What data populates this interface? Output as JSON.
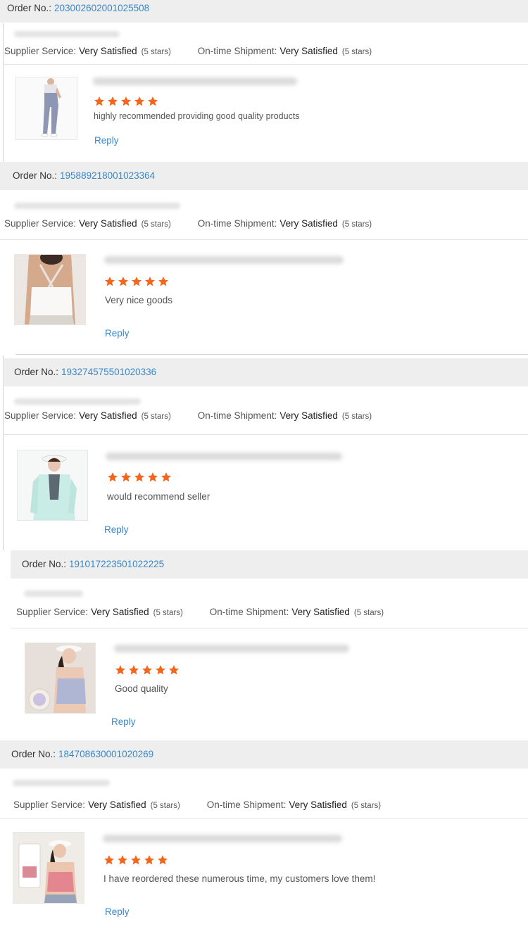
{
  "labels": {
    "order": "Order No.:",
    "supplier_service": "Supplier Service:",
    "ontime_shipment": "On-time Shipment:",
    "reply": "Reply"
  },
  "colors": {
    "link": "#3a87c9",
    "star": "#f2661d",
    "order_bar": "#eeeeee"
  },
  "reviews": [
    {
      "order_no": "203002602001025508",
      "supplier_service": "Very Satisfied",
      "supplier_stars": "(5 stars)",
      "ontime_shipment": "Very Satisfied",
      "ontime_stars": "(5 stars)",
      "rating": 5,
      "comment": "highly recommended providing good quality products",
      "product_image": "leggings-photo"
    },
    {
      "order_no": "195889218001023364",
      "supplier_service": "Very Satisfied",
      "supplier_stars": "(5 stars)",
      "ontime_shipment": "Very Satisfied",
      "ontime_stars": "(5 stars)",
      "rating": 5,
      "comment": "Very nice goods",
      "product_image": "white-sports-bra-photo"
    },
    {
      "order_no": "193274575501020336",
      "supplier_service": "Very Satisfied",
      "supplier_stars": "(5 stars)",
      "ontime_shipment": "Very Satisfied",
      "ontime_stars": "(5 stars)",
      "rating": 5,
      "comment": "would recommend seller",
      "product_image": "mint-jacket-photo"
    },
    {
      "order_no": "191017223501022225",
      "supplier_service": "Very Satisfied",
      "supplier_stars": "(5 stars)",
      "ontime_shipment": "Very Satisfied",
      "ontime_stars": "(5 stars)",
      "rating": 5,
      "comment": "Good quality",
      "product_image": "lavender-bra-photo"
    },
    {
      "order_no": "184708630001020269",
      "supplier_service": "Very Satisfied",
      "supplier_stars": "(5 stars)",
      "ontime_shipment": "Very Satisfied",
      "ontime_stars": "(5 stars)",
      "rating": 5,
      "comment": "I have reordered these numerous time, my customers love them!",
      "product_image": "pink-sports-bra-photo"
    }
  ]
}
